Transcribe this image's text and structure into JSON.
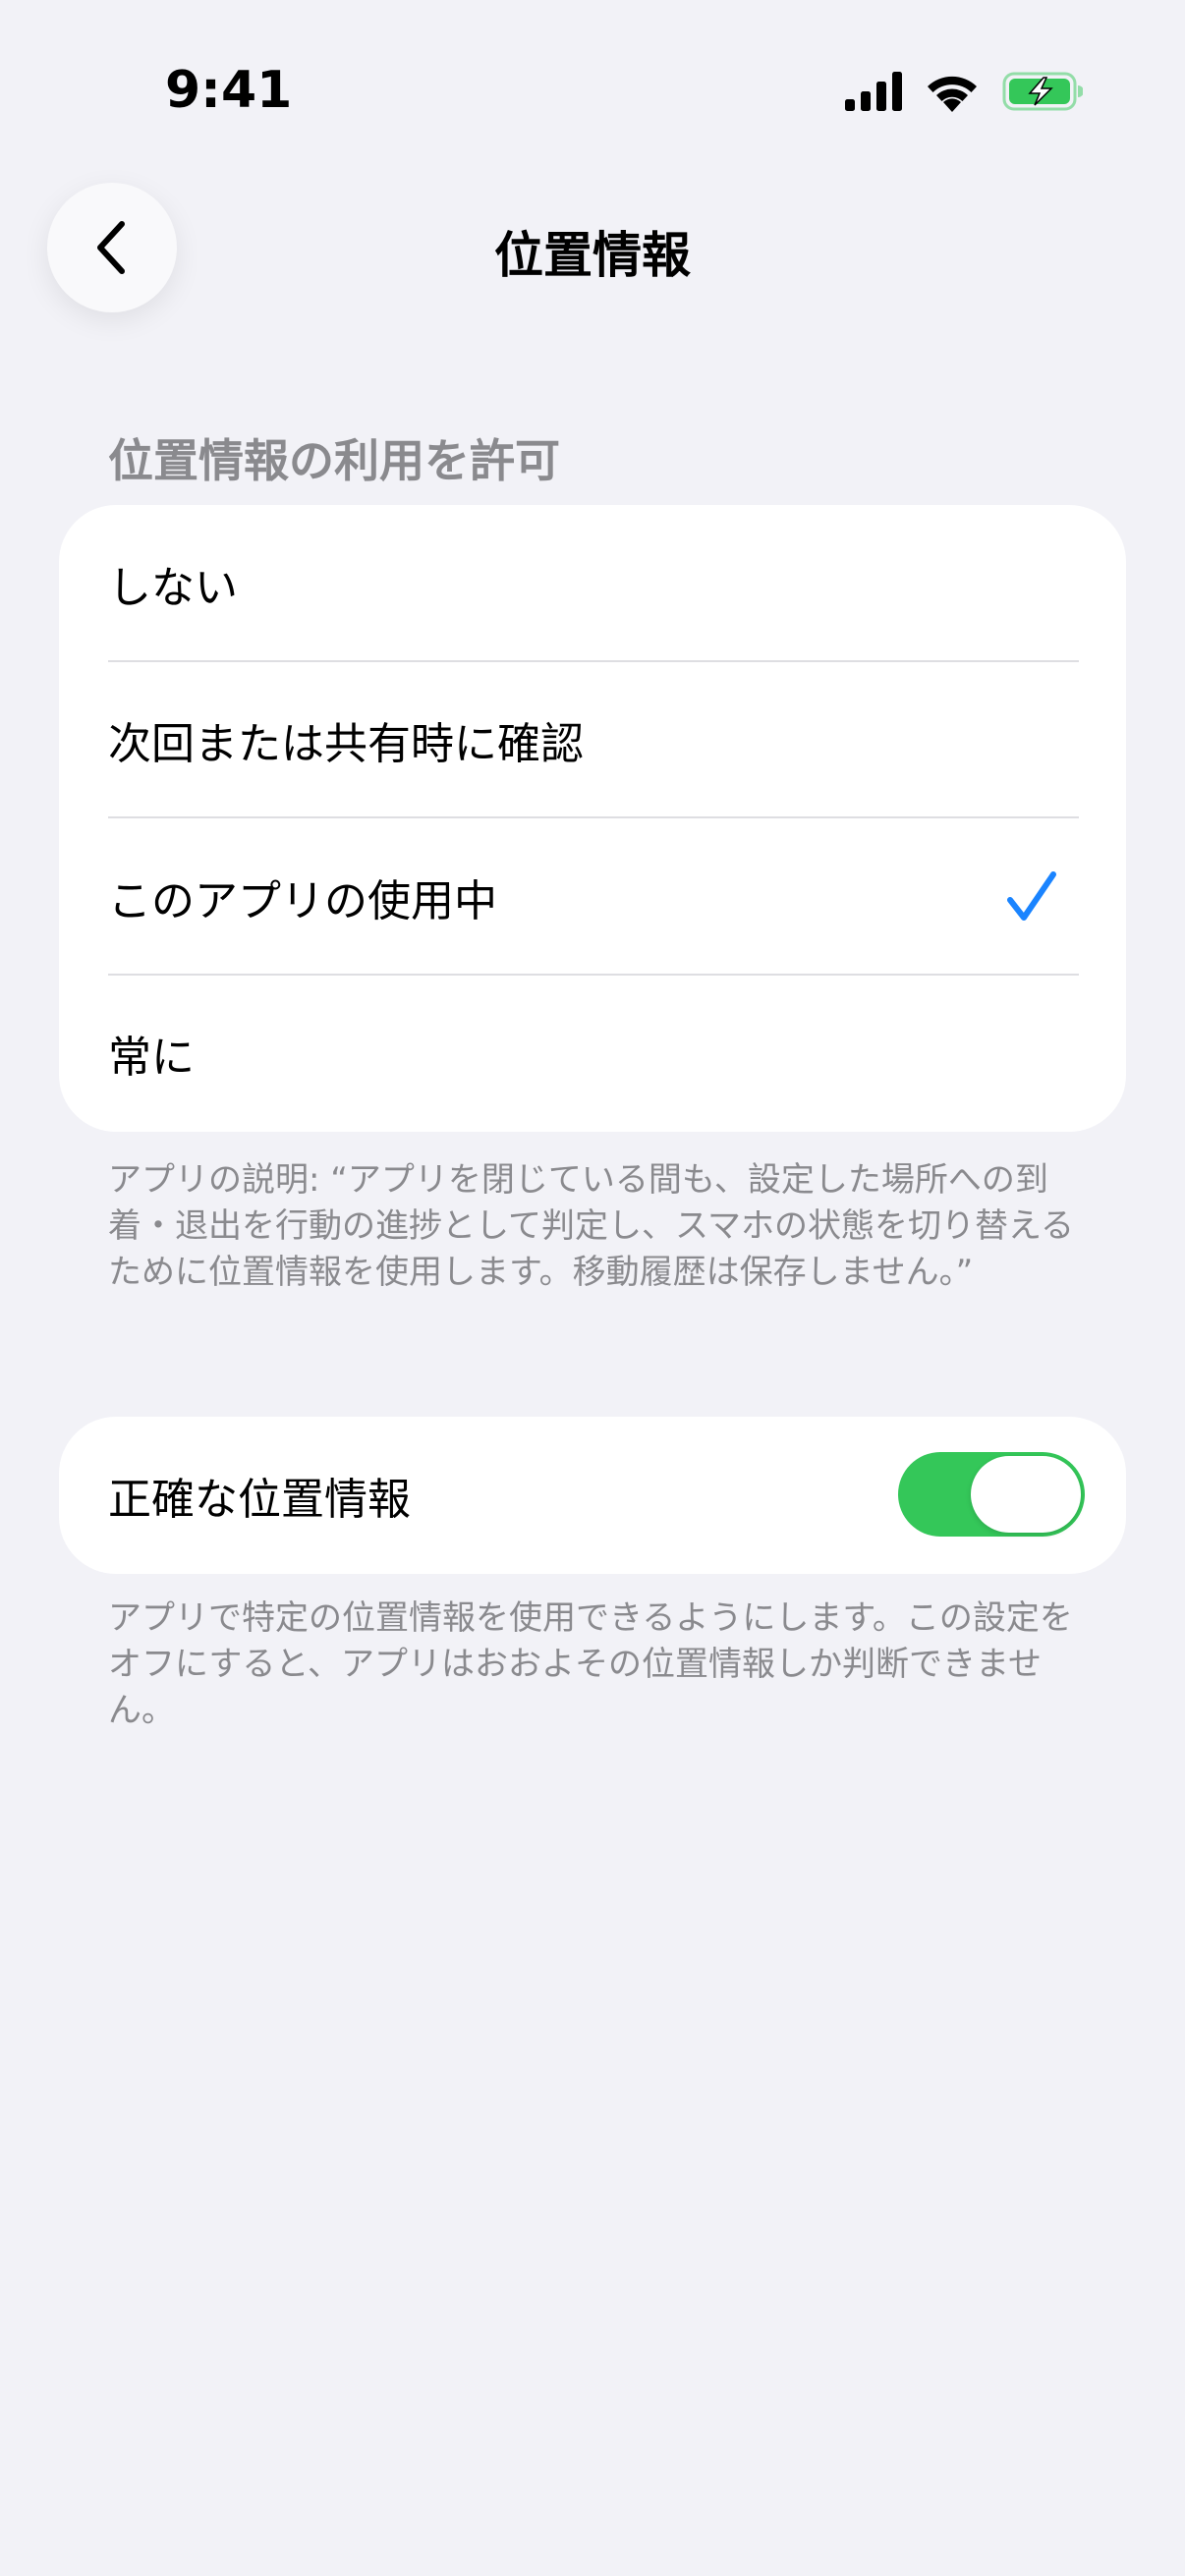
{
  "status_bar": {
    "time": "9:41",
    "icons": [
      "signal-icon",
      "wifi-icon",
      "battery-charging-icon"
    ],
    "battery_color": "#34c759"
  },
  "nav": {
    "title": "位置情報",
    "back_icon": "chevron-left-icon"
  },
  "location_access": {
    "header": "位置情報の利用を許可",
    "options": [
      {
        "label": "しない",
        "selected": false
      },
      {
        "label": "次回または共有時に確認",
        "selected": false
      },
      {
        "label": "このアプリの使用中",
        "selected": true
      },
      {
        "label": "常に",
        "selected": false
      }
    ],
    "check_color": "#1a84ff",
    "footnote": "アプリの説明: “アプリを閉じている間も、設定した場所への到着・退出を行動の進捗として判定し、スマホの状態を切り替えるために位置情報を使用します。移動履歴は保存しません。”"
  },
  "precise_location": {
    "label": "正確な位置情報",
    "enabled": true,
    "toggle_color": "#34c759",
    "footnote": "アプリで特定の位置情報を使用できるようにします。この設定をオフにすると、アプリはおおよその位置情報しか判断できません。"
  }
}
